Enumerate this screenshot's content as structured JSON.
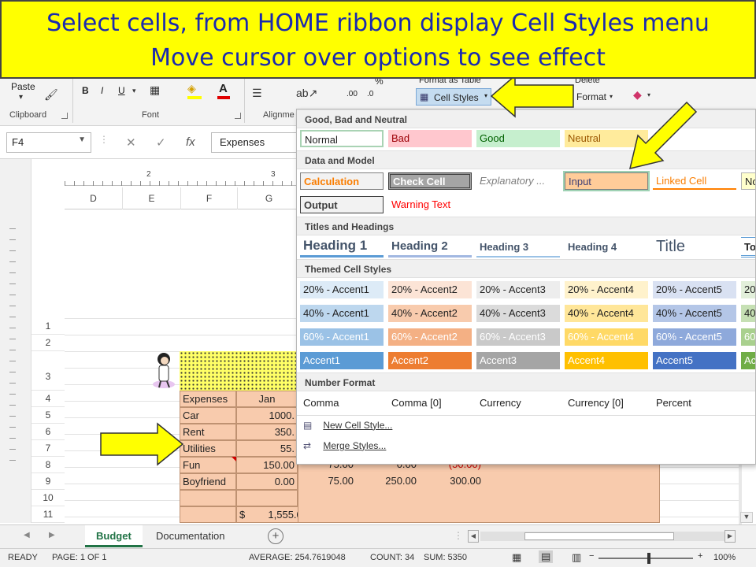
{
  "banner": {
    "line1": "Select cells, from HOME ribbon display Cell Styles menu",
    "line2": "Move cursor over options to see effect"
  },
  "ribbon": {
    "paste_label": "Paste",
    "clipboard_label": "Clipboard",
    "font_label": "Font",
    "alignment_label": "Alignme",
    "format_as_table_label": "Format as Table",
    "cell_styles_label": "Cell Styles",
    "delete_label": "Delete",
    "format_label": "Format",
    "bold": "B",
    "italic": "I",
    "underline": "U",
    "font_color_letter": "A",
    "percent": "%",
    "dec_increase": ".00",
    "dec_decrease": ".0"
  },
  "formula_bar": {
    "name_box": "F4",
    "cancel": "✕",
    "enter": "✓",
    "fx": "fx",
    "value": "Expenses"
  },
  "ruler": {
    "marks": [
      "2",
      "3"
    ]
  },
  "columns": [
    "D",
    "E",
    "F",
    "G"
  ],
  "rows": [
    "1",
    "2",
    "3",
    "4",
    "5",
    "6",
    "7",
    "8",
    "9",
    "10",
    "11"
  ],
  "sheet": {
    "labels": [
      "Expenses",
      "Car",
      "Rent",
      "Utilities",
      "Fun",
      "Boyfriend"
    ],
    "jan_header": "Jan",
    "jan_values": [
      "1000.",
      "350.",
      "55.",
      "150.00",
      "0.00"
    ],
    "row8_values": [
      "75.00",
      "0.00",
      "(50.00)"
    ],
    "row9_values": [
      "75.00",
      "250.00",
      "300.00"
    ],
    "total_symbol": "$",
    "total_value": "1,555.00"
  },
  "gallery": {
    "sections": {
      "good_bad": "Good, Bad and Neutral",
      "data_model": "Data and Model",
      "titles": "Titles and Headings",
      "themed": "Themed Cell Styles",
      "number": "Number Format"
    },
    "good_bad": [
      "Normal",
      "Bad",
      "Good",
      "Neutral"
    ],
    "data_model_row1": [
      "Calculation",
      "Check Cell",
      "Explanatory ...",
      "Input",
      "Linked Cell",
      "No"
    ],
    "data_model_row2": [
      "Output",
      "Warning Text"
    ],
    "titles": [
      "Heading 1",
      "Heading 2",
      "Heading 3",
      "Heading 4",
      "Title",
      "To"
    ],
    "accent20": [
      "20% - Accent1",
      "20% - Accent2",
      "20% - Accent3",
      "20% - Accent4",
      "20% - Accent5",
      "20"
    ],
    "accent40": [
      "40% - Accent1",
      "40% - Accent2",
      "40% - Accent3",
      "40% - Accent4",
      "40% - Accent5",
      "40"
    ],
    "accent60": [
      "60% - Accent1",
      "60% - Accent2",
      "60% - Accent3",
      "60% - Accent4",
      "60% - Accent5",
      "60"
    ],
    "accent100": [
      "Accent1",
      "Accent2",
      "Accent3",
      "Accent4",
      "Accent5",
      "Ac"
    ],
    "number": [
      "Comma",
      "Comma [0]",
      "Currency",
      "Currency [0]",
      "Percent"
    ],
    "new_style": "New Cell Style...",
    "merge_styles": "Merge Styles..."
  },
  "tabs": [
    "Budget",
    "Documentation"
  ],
  "add_sheet": "+",
  "status": {
    "ready": "READY",
    "page": "PAGE: 1 OF 1",
    "average": "AVERAGE: 254.7619048",
    "count": "COUNT: 34",
    "sum": "SUM: 5350",
    "zoom": "100%"
  },
  "colors": {
    "banner_bg": "#ffff00",
    "banner_text": "#1a2ab0",
    "accent1": "#5b9bd5",
    "accent2": "#ed7d31",
    "accent3": "#a5a5a5",
    "accent4": "#ffc000",
    "accent5": "#4472c4",
    "accent6": "#70ad47",
    "peach": "#f8cbad"
  }
}
